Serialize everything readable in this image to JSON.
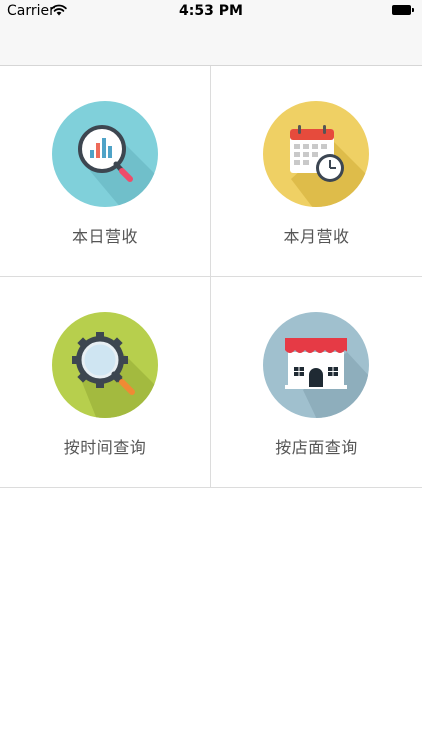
{
  "status_bar": {
    "carrier": "Carrier",
    "time": "4:53 PM",
    "wifi_icon": "wifi-icon",
    "battery_icon": "battery-icon"
  },
  "menu": {
    "items": [
      {
        "label": "本日营收",
        "icon": "daily-revenue-chart-icon",
        "color": "#7ecfd9"
      },
      {
        "label": "本月营收",
        "icon": "calendar-icon",
        "color": "#f0d264"
      },
      {
        "label": "按时间查询",
        "icon": "gear-search-icon",
        "color": "#b6cf4e"
      },
      {
        "label": "按店面查询",
        "icon": "store-icon",
        "color": "#9fbfcd"
      }
    ]
  }
}
